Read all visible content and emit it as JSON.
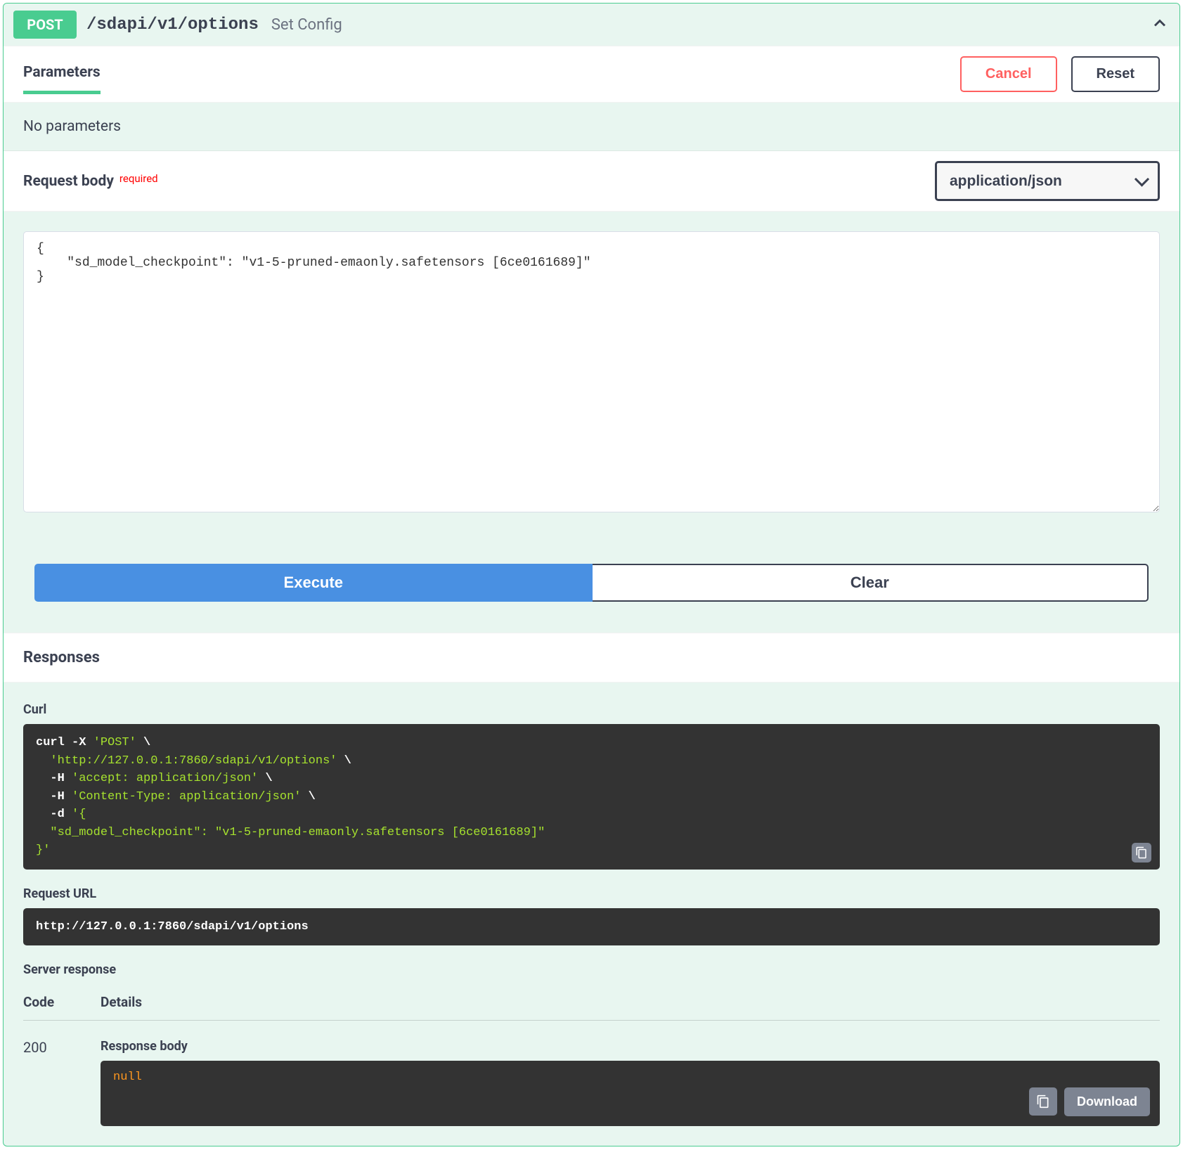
{
  "summary": {
    "method": "POST",
    "path": "/sdapi/v1/options",
    "desc": "Set Config"
  },
  "parameters": {
    "tab_label": "Parameters",
    "cancel": "Cancel",
    "reset": "Reset",
    "no_params": "No parameters"
  },
  "request_body": {
    "title": "Request body",
    "required": "required",
    "content_type": "application/json",
    "textarea_value": "{\n    \"sd_model_checkpoint\": \"v1-5-pruned-emaonly.safetensors [6ce0161689]\"\n}"
  },
  "actions": {
    "execute": "Execute",
    "clear": "Clear"
  },
  "responses": {
    "header": "Responses",
    "curl_label": "Curl",
    "curl_segments": {
      "p0": "curl -X ",
      "p1": "'POST'",
      "p2": " \\\n  ",
      "p3": "'http://127.0.0.1:7860/sdapi/v1/options'",
      "p4": " \\\n  -H ",
      "p5": "'accept: application/json'",
      "p6": " \\\n  -H ",
      "p7": "'Content-Type: application/json'",
      "p8": " \\\n  -d ",
      "p9": "'{\n  \"sd_model_checkpoint\": \"v1-5-pruned-emaonly.safetensors [6ce0161689]\"\n}'"
    },
    "request_url_label": "Request URL",
    "request_url": "http://127.0.0.1:7860/sdapi/v1/options",
    "server_response_label": "Server response",
    "code_col": "Code",
    "details_col": "Details",
    "status_code": "200",
    "response_body_label": "Response body",
    "response_body_value": "null",
    "download": "Download"
  }
}
